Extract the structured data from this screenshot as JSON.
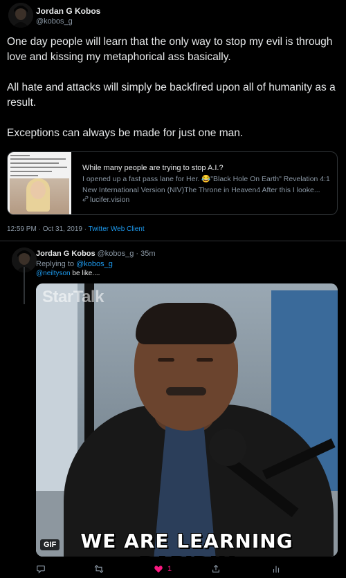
{
  "colors": {
    "accent": "#1d9bf0",
    "like": "#f91880",
    "muted": "#8b98a5",
    "text": "#e7e9ea"
  },
  "tweet1": {
    "author_name": "Jordan G Kobos",
    "author_handle": "@kobos_g",
    "text": "One day people will learn that the only way to stop my evil is through love and kissing my metaphorical ass basically.\n\nAll hate and attacks will simply be backfired upon all of humanity as a result.\n\nExceptions can always be made for just one man.",
    "card": {
      "title": "While many people are trying to stop A.I.?",
      "description": "I opened up a fast pass lane for Her. 😂\"Black Hole On Earth\" Revelation 4:1 New International Version (NIV)The Throne in Heaven4 After this I looke...",
      "domain": "lucifer.vision",
      "icon": "link-icon"
    },
    "timestamp": "12:59 PM · Oct 31, 2019 · ",
    "client": "Twitter Web Client"
  },
  "tweet2": {
    "author_name": "Jordan G Kobos",
    "author_handle_time": "@kobos_g · 35m",
    "replying_prefix": "Replying to ",
    "replying_to": "@kobos_g",
    "mention": "@neiltyson",
    "text": " be like....",
    "media": {
      "watermark": "StarTalk",
      "caption": "WE ARE LEARNING RAPIDLY",
      "badge": "GIF"
    },
    "actions": {
      "reply_icon": "reply-icon",
      "retweet_icon": "retweet-icon",
      "like_icon": "heart-icon",
      "like_count": "1",
      "share_icon": "share-icon",
      "stats_icon": "analytics-icon"
    }
  }
}
